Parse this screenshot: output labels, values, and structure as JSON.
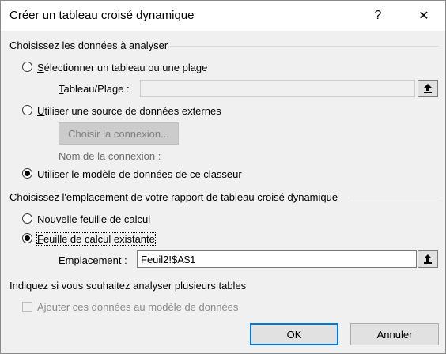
{
  "window": {
    "title": "Créer un tableau croisé dynamique",
    "help_glyph": "?",
    "close_glyph": "✕"
  },
  "source_section": {
    "label": "Choisissez les données à analyser",
    "option_range": {
      "pre": "",
      "accel": "S",
      "post": "électionner un tableau ou une plage",
      "selected": false
    },
    "range_field": {
      "label_pre": "",
      "label_accel": "T",
      "label_post": "ableau/Plage :",
      "value": ""
    },
    "option_external": {
      "pre": "",
      "accel": "U",
      "post": "tiliser une source de données externes",
      "selected": false
    },
    "choose_connection_label": "Choisir la connexion...",
    "connection_name_label": "Nom de la connexion :",
    "option_datamodel": {
      "pre": "Utiliser le modèle de ",
      "accel": "d",
      "post": "onnées de ce classeur",
      "selected": true
    }
  },
  "placement_section": {
    "label": "Choisissez l'emplacement de votre rapport de tableau croisé dynamique",
    "option_new_sheet": {
      "pre": "",
      "accel": "N",
      "post": "ouvelle feuille de calcul",
      "selected": false
    },
    "option_existing_sheet": {
      "pre": "",
      "accel": "F",
      "post": "euille de calcul existante",
      "selected": true
    },
    "location_field": {
      "label_pre": "Emp",
      "label_accel": "l",
      "label_post": "acement :",
      "value": "Feuil2!$A$1"
    }
  },
  "multi_section": {
    "label": "Indiquez si vous souhaitez analyser plusieurs tables",
    "checkbox_label": "Ajouter ces données au modèle de données",
    "checked": false
  },
  "buttons": {
    "ok_label": "OK",
    "cancel_label": "Annuler"
  },
  "icons": {
    "range_ref": "collapse-dialog-icon",
    "location_ref": "collapse-dialog-icon"
  }
}
